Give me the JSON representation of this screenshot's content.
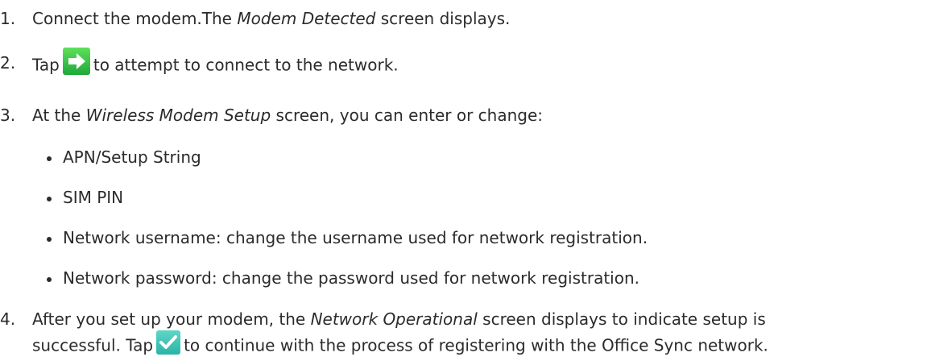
{
  "steps": [
    {
      "number": "1.",
      "pre": "Connect the modem.The ",
      "em": "Modem Detected",
      "post": " screen displays."
    },
    {
      "number": "2.",
      "pre": "Tap",
      "icon": "green-right-arrow-icon",
      "post": "to attempt to connect to the network."
    },
    {
      "number": "3.",
      "pre": "At the ",
      "em": "Wireless Modem Setup",
      "post": " screen, you can enter or change:",
      "bullets": [
        "APN/Setup String",
        "SIM PIN",
        "Network username: change the username used for network registration.",
        "Network password: change the password used for network registration."
      ]
    },
    {
      "number": "4.",
      "pre": "After you set up your modem, the ",
      "em": "Network Operational",
      "post": " screen displays to indicate setup is",
      "line2_pre": "successful. Tap",
      "icon": "green-checkmark-icon",
      "line2_post": "to continue with the process of registering with the Office Sync network."
    }
  ],
  "colors": {
    "text": "#2b2b2b",
    "icon_green": "#3cc13c"
  }
}
